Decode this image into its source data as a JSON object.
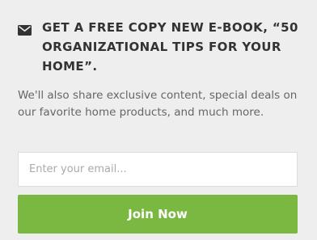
{
  "signup": {
    "icon": "envelope-icon",
    "heading": "GET A FREE COPY NEW E-BOOK, “50 ORGANIZATIONAL TIPS FOR YOUR HOME”.",
    "description": "We'll also share exclusive content, special deals on our favorite home products, and much more.",
    "email_value": "",
    "email_placeholder": "Enter your email...",
    "button_label": "Join Now"
  },
  "colors": {
    "background": "#eeeeee",
    "heading_text": "#333333",
    "body_text": "#666666",
    "button": "#7ab841",
    "button_text": "#ffffff"
  }
}
